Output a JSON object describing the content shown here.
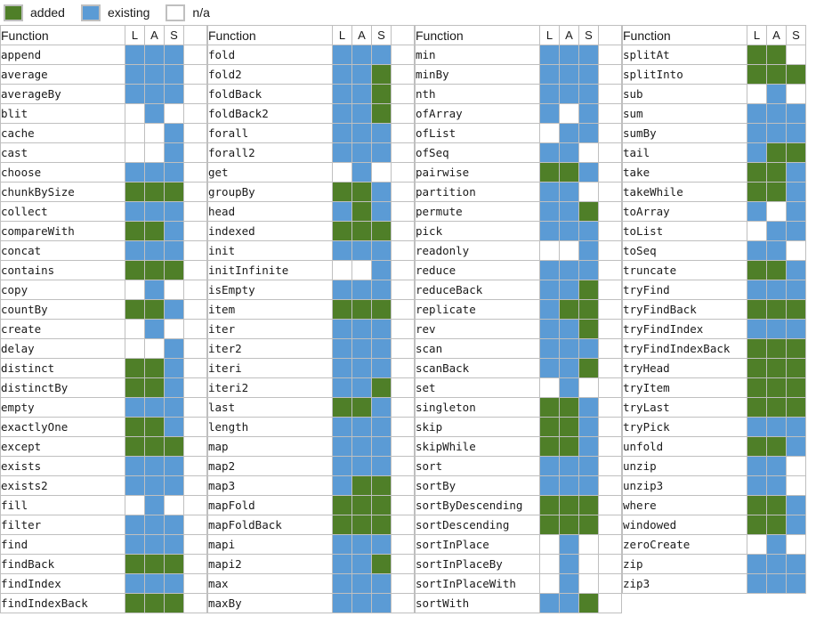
{
  "legend": {
    "items": [
      {
        "label": "added",
        "state": "added",
        "color": "#4f7f28"
      },
      {
        "label": "existing",
        "state": "existing",
        "color": "#5b9bd5"
      },
      {
        "label": "n/a",
        "state": "na",
        "color": "#ffffff"
      }
    ]
  },
  "table": {
    "headers": {
      "function": "Function",
      "flags": [
        "L",
        "A",
        "S"
      ]
    },
    "columns": [
      {
        "name_width": 140,
        "spacer_width": 26,
        "rows": [
          {
            "fn": "append",
            "flags": [
              "existing",
              "existing",
              "existing"
            ]
          },
          {
            "fn": "average",
            "flags": [
              "existing",
              "existing",
              "existing"
            ]
          },
          {
            "fn": "averageBy",
            "flags": [
              "existing",
              "existing",
              "existing"
            ]
          },
          {
            "fn": "blit",
            "flags": [
              "na",
              "existing",
              "na"
            ]
          },
          {
            "fn": "cache",
            "flags": [
              "na",
              "na",
              "existing"
            ]
          },
          {
            "fn": "cast",
            "flags": [
              "na",
              "na",
              "existing"
            ]
          },
          {
            "fn": "choose",
            "flags": [
              "existing",
              "existing",
              "existing"
            ]
          },
          {
            "fn": "chunkBySize",
            "flags": [
              "added",
              "added",
              "added"
            ]
          },
          {
            "fn": "collect",
            "flags": [
              "existing",
              "existing",
              "existing"
            ]
          },
          {
            "fn": "compareWith",
            "flags": [
              "added",
              "added",
              "existing"
            ]
          },
          {
            "fn": "concat",
            "flags": [
              "existing",
              "existing",
              "existing"
            ]
          },
          {
            "fn": "contains",
            "flags": [
              "added",
              "added",
              "added"
            ]
          },
          {
            "fn": "copy",
            "flags": [
              "na",
              "existing",
              "na"
            ]
          },
          {
            "fn": "countBy",
            "flags": [
              "added",
              "added",
              "existing"
            ]
          },
          {
            "fn": "create",
            "flags": [
              "na",
              "existing",
              "na"
            ]
          },
          {
            "fn": "delay",
            "flags": [
              "na",
              "na",
              "existing"
            ]
          },
          {
            "fn": "distinct",
            "flags": [
              "added",
              "added",
              "existing"
            ]
          },
          {
            "fn": "distinctBy",
            "flags": [
              "added",
              "added",
              "existing"
            ]
          },
          {
            "fn": "empty",
            "flags": [
              "existing",
              "existing",
              "existing"
            ]
          },
          {
            "fn": "exactlyOne",
            "flags": [
              "added",
              "added",
              "existing"
            ]
          },
          {
            "fn": "except",
            "flags": [
              "added",
              "added",
              "added"
            ]
          },
          {
            "fn": "exists",
            "flags": [
              "existing",
              "existing",
              "existing"
            ]
          },
          {
            "fn": "exists2",
            "flags": [
              "existing",
              "existing",
              "existing"
            ]
          },
          {
            "fn": "fill",
            "flags": [
              "na",
              "existing",
              "na"
            ]
          },
          {
            "fn": "filter",
            "flags": [
              "existing",
              "existing",
              "existing"
            ]
          },
          {
            "fn": "find",
            "flags": [
              "existing",
              "existing",
              "existing"
            ]
          },
          {
            "fn": "findBack",
            "flags": [
              "added",
              "added",
              "added"
            ]
          },
          {
            "fn": "findIndex",
            "flags": [
              "existing",
              "existing",
              "existing"
            ]
          },
          {
            "fn": "findIndexBack",
            "flags": [
              "added",
              "added",
              "added"
            ]
          }
        ]
      },
      {
        "name_width": 140,
        "spacer_width": 26,
        "rows": [
          {
            "fn": "fold",
            "flags": [
              "existing",
              "existing",
              "existing"
            ]
          },
          {
            "fn": "fold2",
            "flags": [
              "existing",
              "existing",
              "added"
            ]
          },
          {
            "fn": "foldBack",
            "flags": [
              "existing",
              "existing",
              "added"
            ]
          },
          {
            "fn": "foldBack2",
            "flags": [
              "existing",
              "existing",
              "added"
            ]
          },
          {
            "fn": "forall",
            "flags": [
              "existing",
              "existing",
              "existing"
            ]
          },
          {
            "fn": "forall2",
            "flags": [
              "existing",
              "existing",
              "existing"
            ]
          },
          {
            "fn": "get",
            "flags": [
              "na",
              "existing",
              "na"
            ]
          },
          {
            "fn": "groupBy",
            "flags": [
              "added",
              "added",
              "existing"
            ]
          },
          {
            "fn": "head",
            "flags": [
              "existing",
              "added",
              "existing"
            ]
          },
          {
            "fn": "indexed",
            "flags": [
              "added",
              "added",
              "added"
            ]
          },
          {
            "fn": "init",
            "flags": [
              "existing",
              "existing",
              "existing"
            ]
          },
          {
            "fn": "initInfinite",
            "flags": [
              "na",
              "na",
              "existing"
            ]
          },
          {
            "fn": "isEmpty",
            "flags": [
              "existing",
              "existing",
              "existing"
            ]
          },
          {
            "fn": "item",
            "flags": [
              "added",
              "added",
              "added"
            ]
          },
          {
            "fn": "iter",
            "flags": [
              "existing",
              "existing",
              "existing"
            ]
          },
          {
            "fn": "iter2",
            "flags": [
              "existing",
              "existing",
              "existing"
            ]
          },
          {
            "fn": "iteri",
            "flags": [
              "existing",
              "existing",
              "existing"
            ]
          },
          {
            "fn": "iteri2",
            "flags": [
              "existing",
              "existing",
              "added"
            ]
          },
          {
            "fn": "last",
            "flags": [
              "added",
              "added",
              "existing"
            ]
          },
          {
            "fn": "length",
            "flags": [
              "existing",
              "existing",
              "existing"
            ]
          },
          {
            "fn": "map",
            "flags": [
              "existing",
              "existing",
              "existing"
            ]
          },
          {
            "fn": "map2",
            "flags": [
              "existing",
              "existing",
              "existing"
            ]
          },
          {
            "fn": "map3",
            "flags": [
              "existing",
              "added",
              "added"
            ]
          },
          {
            "fn": "mapFold",
            "flags": [
              "added",
              "added",
              "added"
            ]
          },
          {
            "fn": "mapFoldBack",
            "flags": [
              "added",
              "added",
              "added"
            ]
          },
          {
            "fn": "mapi",
            "flags": [
              "existing",
              "existing",
              "existing"
            ]
          },
          {
            "fn": "mapi2",
            "flags": [
              "existing",
              "existing",
              "added"
            ]
          },
          {
            "fn": "max",
            "flags": [
              "existing",
              "existing",
              "existing"
            ]
          },
          {
            "fn": "maxBy",
            "flags": [
              "existing",
              "existing",
              "existing"
            ]
          }
        ]
      },
      {
        "name_width": 140,
        "spacer_width": 26,
        "rows": [
          {
            "fn": "min",
            "flags": [
              "existing",
              "existing",
              "existing"
            ]
          },
          {
            "fn": "minBy",
            "flags": [
              "existing",
              "existing",
              "existing"
            ]
          },
          {
            "fn": "nth",
            "flags": [
              "existing",
              "existing",
              "existing"
            ]
          },
          {
            "fn": "ofArray",
            "flags": [
              "existing",
              "na",
              "existing"
            ]
          },
          {
            "fn": "ofList",
            "flags": [
              "na",
              "existing",
              "existing"
            ]
          },
          {
            "fn": "ofSeq",
            "flags": [
              "existing",
              "existing",
              "na"
            ]
          },
          {
            "fn": "pairwise",
            "flags": [
              "added",
              "added",
              "existing"
            ]
          },
          {
            "fn": "partition",
            "flags": [
              "existing",
              "existing",
              "na"
            ]
          },
          {
            "fn": "permute",
            "flags": [
              "existing",
              "existing",
              "added"
            ]
          },
          {
            "fn": "pick",
            "flags": [
              "existing",
              "existing",
              "existing"
            ]
          },
          {
            "fn": "readonly",
            "flags": [
              "na",
              "na",
              "existing"
            ]
          },
          {
            "fn": "reduce",
            "flags": [
              "existing",
              "existing",
              "existing"
            ]
          },
          {
            "fn": "reduceBack",
            "flags": [
              "existing",
              "existing",
              "added"
            ]
          },
          {
            "fn": "replicate",
            "flags": [
              "existing",
              "added",
              "added"
            ]
          },
          {
            "fn": "rev",
            "flags": [
              "existing",
              "existing",
              "added"
            ]
          },
          {
            "fn": "scan",
            "flags": [
              "existing",
              "existing",
              "existing"
            ]
          },
          {
            "fn": "scanBack",
            "flags": [
              "existing",
              "existing",
              "added"
            ]
          },
          {
            "fn": "set",
            "flags": [
              "na",
              "existing",
              "na"
            ]
          },
          {
            "fn": "singleton",
            "flags": [
              "added",
              "added",
              "existing"
            ]
          },
          {
            "fn": "skip",
            "flags": [
              "added",
              "added",
              "existing"
            ]
          },
          {
            "fn": "skipWhile",
            "flags": [
              "added",
              "added",
              "existing"
            ]
          },
          {
            "fn": "sort",
            "flags": [
              "existing",
              "existing",
              "existing"
            ]
          },
          {
            "fn": "sortBy",
            "flags": [
              "existing",
              "existing",
              "existing"
            ]
          },
          {
            "fn": "sortByDescending",
            "flags": [
              "added",
              "added",
              "added"
            ]
          },
          {
            "fn": "sortDescending",
            "flags": [
              "added",
              "added",
              "added"
            ]
          },
          {
            "fn": "sortInPlace",
            "flags": [
              "na",
              "existing",
              "na"
            ]
          },
          {
            "fn": "sortInPlaceBy",
            "flags": [
              "na",
              "existing",
              "na"
            ]
          },
          {
            "fn": "sortInPlaceWith",
            "flags": [
              "na",
              "existing",
              "na"
            ]
          },
          {
            "fn": "sortWith",
            "flags": [
              "existing",
              "existing",
              "added"
            ]
          }
        ]
      },
      {
        "name_width": 140,
        "spacer_width": 0,
        "rows": [
          {
            "fn": "splitAt",
            "flags": [
              "added",
              "added",
              "na"
            ]
          },
          {
            "fn": "splitInto",
            "flags": [
              "added",
              "added",
              "added"
            ]
          },
          {
            "fn": "sub",
            "flags": [
              "na",
              "existing",
              "na"
            ]
          },
          {
            "fn": "sum",
            "flags": [
              "existing",
              "existing",
              "existing"
            ]
          },
          {
            "fn": "sumBy",
            "flags": [
              "existing",
              "existing",
              "existing"
            ]
          },
          {
            "fn": "tail",
            "flags": [
              "existing",
              "added",
              "added"
            ]
          },
          {
            "fn": "take",
            "flags": [
              "added",
              "added",
              "existing"
            ]
          },
          {
            "fn": "takeWhile",
            "flags": [
              "added",
              "added",
              "existing"
            ]
          },
          {
            "fn": "toArray",
            "flags": [
              "existing",
              "na",
              "existing"
            ]
          },
          {
            "fn": "toList",
            "flags": [
              "na",
              "existing",
              "existing"
            ]
          },
          {
            "fn": "toSeq",
            "flags": [
              "existing",
              "existing",
              "na"
            ]
          },
          {
            "fn": "truncate",
            "flags": [
              "added",
              "added",
              "existing"
            ]
          },
          {
            "fn": "tryFind",
            "flags": [
              "existing",
              "existing",
              "existing"
            ]
          },
          {
            "fn": "tryFindBack",
            "flags": [
              "added",
              "added",
              "added"
            ]
          },
          {
            "fn": "tryFindIndex",
            "flags": [
              "existing",
              "existing",
              "existing"
            ]
          },
          {
            "fn": "tryFindIndexBack",
            "flags": [
              "added",
              "added",
              "added"
            ]
          },
          {
            "fn": "tryHead",
            "flags": [
              "added",
              "added",
              "added"
            ]
          },
          {
            "fn": "tryItem",
            "flags": [
              "added",
              "added",
              "added"
            ]
          },
          {
            "fn": "tryLast",
            "flags": [
              "added",
              "added",
              "added"
            ]
          },
          {
            "fn": "tryPick",
            "flags": [
              "existing",
              "existing",
              "existing"
            ]
          },
          {
            "fn": "unfold",
            "flags": [
              "added",
              "added",
              "existing"
            ]
          },
          {
            "fn": "unzip",
            "flags": [
              "existing",
              "existing",
              "na"
            ]
          },
          {
            "fn": "unzip3",
            "flags": [
              "existing",
              "existing",
              "na"
            ]
          },
          {
            "fn": "where",
            "flags": [
              "added",
              "added",
              "existing"
            ]
          },
          {
            "fn": "windowed",
            "flags": [
              "added",
              "added",
              "existing"
            ]
          },
          {
            "fn": "zeroCreate",
            "flags": [
              "na",
              "existing",
              "na"
            ]
          },
          {
            "fn": "zip",
            "flags": [
              "existing",
              "existing",
              "existing"
            ]
          },
          {
            "fn": "zip3",
            "flags": [
              "existing",
              "existing",
              "existing"
            ]
          }
        ]
      }
    ]
  }
}
